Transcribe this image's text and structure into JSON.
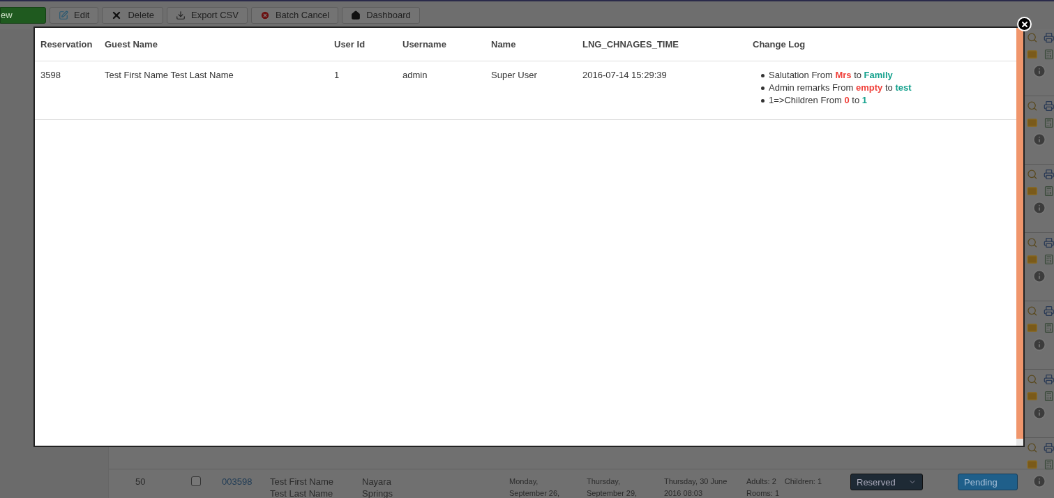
{
  "toolbar": [
    {
      "label": "ew",
      "kind": "new"
    },
    {
      "label": "Edit",
      "kind": "edit"
    },
    {
      "label": "Delete",
      "kind": "delete"
    },
    {
      "label": "Export CSV",
      "kind": "export"
    },
    {
      "label": "Batch Cancel",
      "kind": "cancel"
    },
    {
      "label": "Dashboard",
      "kind": "dashboard"
    }
  ],
  "background_row": {
    "number": "50",
    "checked": false,
    "reservation": "003598",
    "guest": [
      "Test First Name",
      "Test Last Name"
    ],
    "hotel": [
      "Nayara",
      "Springs"
    ],
    "checkin": [
      "Monday,",
      "September 26,"
    ],
    "checkout": [
      "Thursday,",
      "September 29,"
    ],
    "created": [
      "Thursday, 30 June",
      "2016 08:03"
    ],
    "adults": "Adults: 2",
    "children": "Children: 1",
    "rooms": "Rooms: 1",
    "status": "Reserved",
    "payment": "Pending"
  },
  "modal": {
    "columns": [
      "Reservation",
      "Guest Name",
      "User Id",
      "Username",
      "Name",
      "LNG_CHNAGES_TIME",
      "Change Log"
    ],
    "rows": [
      {
        "reservation": "3598",
        "guest_name": "Test First Name Test Last Name",
        "user_id": "1",
        "username": "admin",
        "name": "Super User",
        "time": "2016-07-14 15:29:39",
        "changes": [
          {
            "field": "Salutation From",
            "from": "Mrs",
            "joiner": "to",
            "to": "Family"
          },
          {
            "field": "Admin remarks From",
            "from": "empty",
            "joiner": "to",
            "to": "test"
          },
          {
            "field": "1=>Children From",
            "from": "0",
            "joiner": "to",
            "to": "1"
          }
        ]
      }
    ]
  }
}
